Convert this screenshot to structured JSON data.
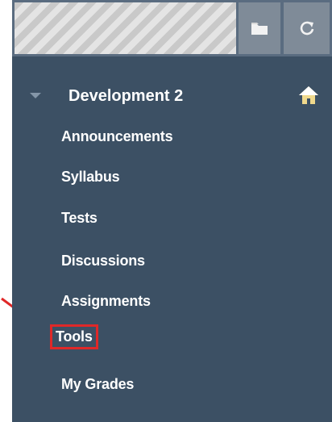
{
  "toolbar": {
    "folder_icon": "folder-icon",
    "refresh_icon": "refresh-icon"
  },
  "course": {
    "title": "Development 2",
    "expand_icon": "triangle-down-icon",
    "home_icon": "home-icon"
  },
  "nav": {
    "items": [
      {
        "label": "Announcements"
      },
      {
        "label": "Syllabus"
      },
      {
        "label": "Tests"
      },
      {
        "label": "Discussions"
      },
      {
        "label": "Assignments"
      },
      {
        "label": "Tools",
        "highlighted": true
      },
      {
        "label": "My Grades"
      }
    ]
  },
  "annotation": {
    "arrow_color": "#e02828",
    "highlight_color": "#e02828"
  },
  "colors": {
    "panel_bg": "#3c5064",
    "text": "#ffffff"
  }
}
